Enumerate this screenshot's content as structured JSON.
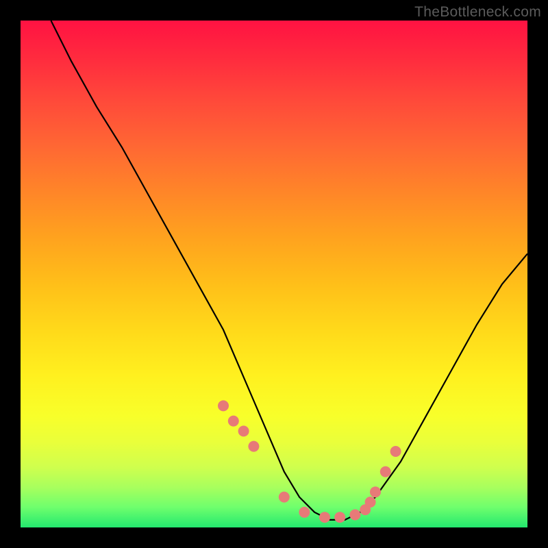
{
  "watermark": "TheBottleneck.com",
  "chart_data": {
    "type": "line",
    "title": "",
    "xlabel": "",
    "ylabel": "",
    "xlim": [
      0,
      100
    ],
    "ylim": [
      0,
      100
    ],
    "series": [
      {
        "name": "curve",
        "x": [
          6,
          10,
          15,
          20,
          25,
          30,
          35,
          40,
          43,
          46,
          49,
          52,
          55,
          58,
          61,
          64,
          67,
          70,
          75,
          80,
          85,
          90,
          95,
          100
        ],
        "y": [
          100,
          92,
          83,
          75,
          66,
          57,
          48,
          39,
          32,
          25,
          18,
          11,
          6,
          3,
          1.5,
          1.5,
          3,
          6,
          13,
          22,
          31,
          40,
          48,
          54
        ]
      }
    ],
    "markers": {
      "name": "red-dots",
      "x": [
        40,
        42,
        44,
        46,
        52,
        56,
        60,
        63,
        66,
        68,
        69,
        70,
        72,
        74
      ],
      "y": [
        24,
        21,
        19,
        16,
        6,
        3,
        2,
        2,
        2.5,
        3.5,
        5,
        7,
        11,
        15
      ]
    },
    "gradient_stops": [
      {
        "pos": 0,
        "color": "#ff1242"
      },
      {
        "pos": 50,
        "color": "#ffbf19"
      },
      {
        "pos": 80,
        "color": "#f8ff2a"
      },
      {
        "pos": 100,
        "color": "#23e86e"
      }
    ]
  }
}
